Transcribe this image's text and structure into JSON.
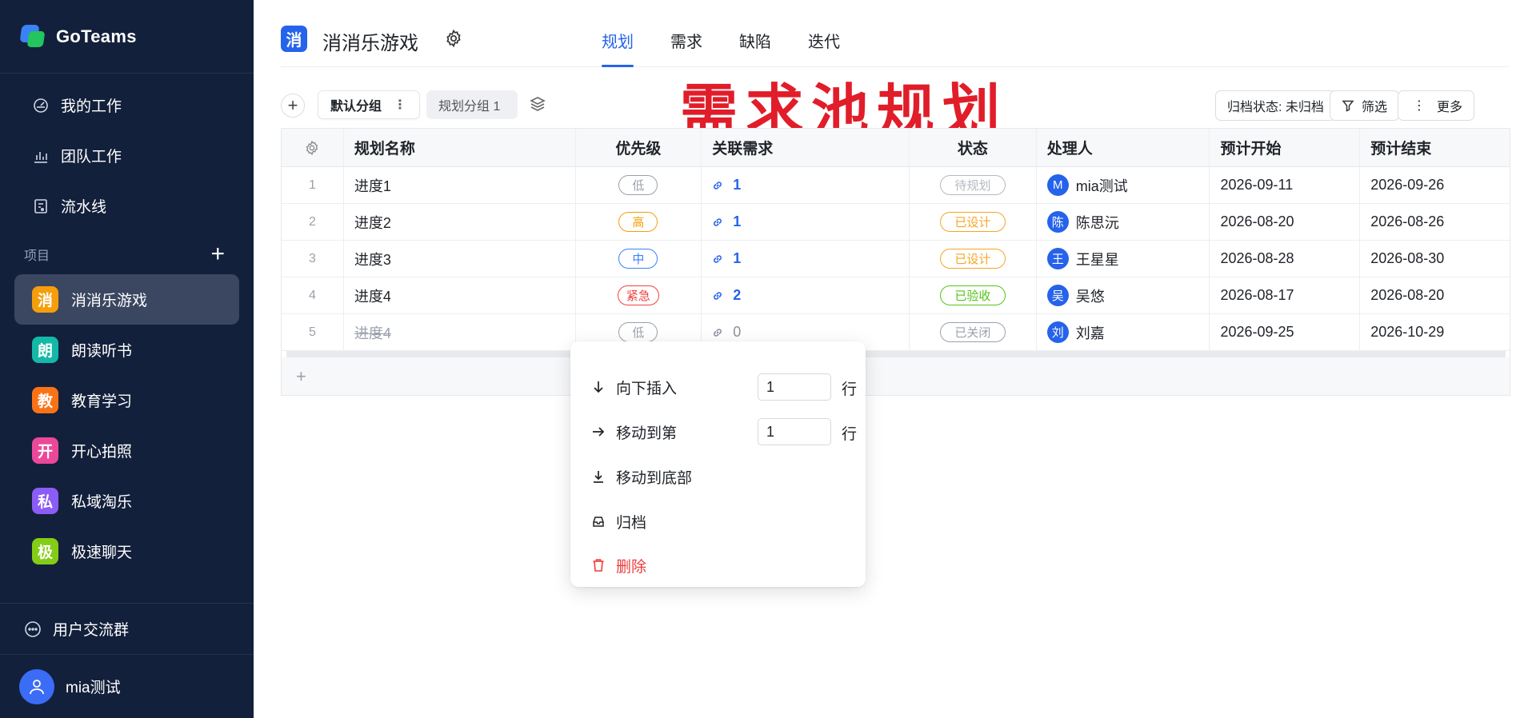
{
  "brand": {
    "name": "GoTeams"
  },
  "nav": [
    {
      "label": "我的工作",
      "icon": "dashboard-icon"
    },
    {
      "label": "团队工作",
      "icon": "bar-chart-icon"
    },
    {
      "label": "流水线",
      "icon": "pipeline-icon"
    }
  ],
  "projects_section": {
    "title": "项目",
    "add": "+"
  },
  "projects": [
    {
      "badge": "消",
      "label": "消消乐游戏",
      "color": "#f59e0b",
      "active": true
    },
    {
      "badge": "朗",
      "label": "朗读听书",
      "color": "#14b8a6"
    },
    {
      "badge": "教",
      "label": "教育学习",
      "color": "#f97316"
    },
    {
      "badge": "开",
      "label": "开心拍照",
      "color": "#ec4899"
    },
    {
      "badge": "私",
      "label": "私域淘乐",
      "color": "#8b5cf6"
    },
    {
      "badge": "极",
      "label": "极速聊天",
      "color": "#84cc16"
    }
  ],
  "sidebar_bottom": {
    "community": "用户交流群",
    "user": "mia测试"
  },
  "header": {
    "badge": "消",
    "title": "消消乐游戏",
    "tabs": [
      "规划",
      "需求",
      "缺陷",
      "迭代"
    ],
    "active_tab": "规划"
  },
  "overlay_title": "需求池规划",
  "toolbar": {
    "add": "+",
    "groups": [
      "默认分组",
      "规划分组 1"
    ],
    "archive_status": "归档状态: 未归档",
    "filter": "筛选",
    "more": "更多"
  },
  "table": {
    "columns": [
      "规划名称",
      "优先级",
      "关联需求",
      "状态",
      "处理人",
      "预计开始",
      "预计结束"
    ],
    "rows": [
      {
        "idx": "1",
        "name": "进度1",
        "priority": "低",
        "pcolor": "#9aa1ab",
        "link": "1",
        "status": "待规划",
        "scolor": "#b4b9c1",
        "avatar": "M",
        "assignee": "mia测试",
        "start": "2026-09-11",
        "end": "2026-09-26"
      },
      {
        "idx": "2",
        "name": "进度2",
        "priority": "高",
        "pcolor": "#f59e0b",
        "link": "1",
        "status": "已设计",
        "scolor": "#f5a623",
        "avatar": "陈",
        "assignee": "陈思沅",
        "start": "2026-08-20",
        "end": "2026-08-26"
      },
      {
        "idx": "3",
        "name": "进度3",
        "priority": "中",
        "pcolor": "#3b82f6",
        "link": "1",
        "status": "已设计",
        "scolor": "#f5a623",
        "avatar": "王",
        "assignee": "王星星",
        "start": "2026-08-28",
        "end": "2026-08-30"
      },
      {
        "idx": "4",
        "name": "进度4",
        "priority": "紧急",
        "pcolor": "#ef4444",
        "link": "2",
        "status": "已验收",
        "scolor": "#52c41a",
        "avatar": "吴",
        "assignee": "吴悠",
        "start": "2026-08-17",
        "end": "2026-08-20"
      },
      {
        "idx": "5",
        "name": "进度4",
        "priority": "低",
        "pcolor": "#9aa1ab",
        "link": "0",
        "status": "已关闭",
        "scolor": "#9aa1ab",
        "avatar": "刘",
        "assignee": "刘嘉",
        "start": "2026-09-25",
        "end": "2026-10-29",
        "faded": true
      }
    ],
    "add_row": "+"
  },
  "menu": {
    "insert_below": "向下插入",
    "insert_value": "1",
    "move_to": "移动到第",
    "move_value": "1",
    "row_unit": "行",
    "move_bottom": "移动到底部",
    "archive": "归档",
    "delete": "删除"
  }
}
